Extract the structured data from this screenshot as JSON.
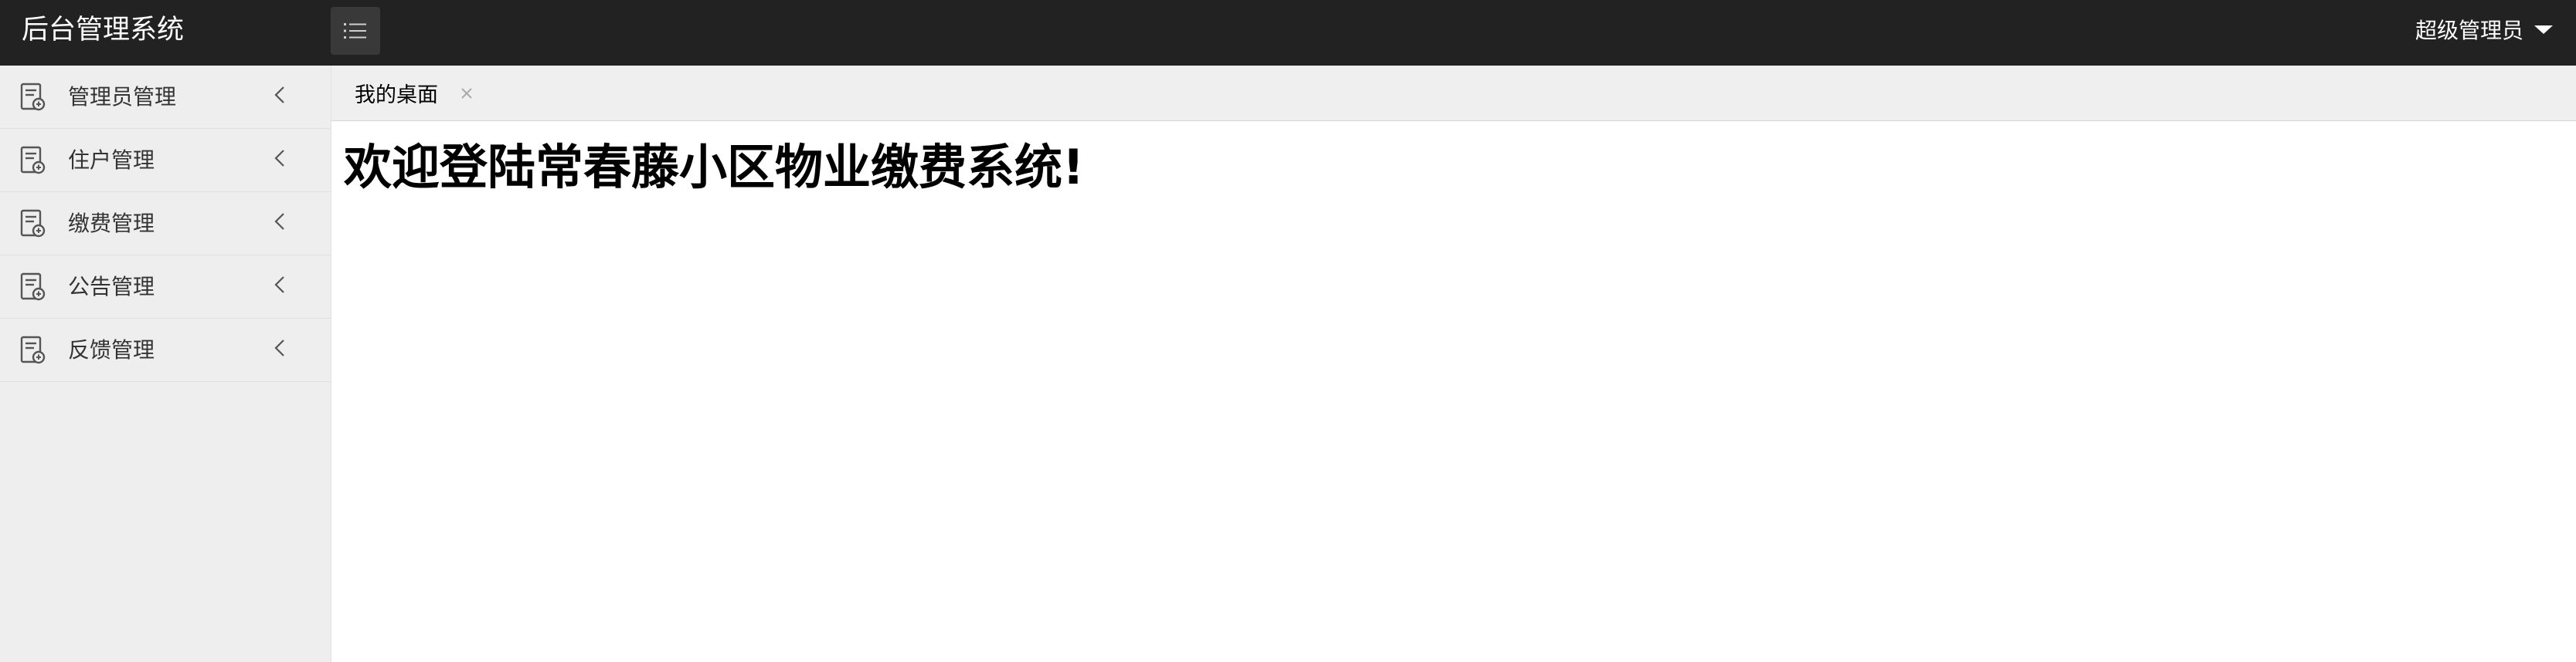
{
  "header": {
    "app_title": "后台管理系统",
    "menu_toggle_icon": "list-icon",
    "user_name": "超级管理员",
    "user_caret_icon": "caret-down-icon",
    "background_color": "#222222"
  },
  "sidebar": {
    "items": [
      {
        "label": "管理员管理",
        "icon": "document-icon",
        "chevron": "chevron-left-icon"
      },
      {
        "label": "住户管理",
        "icon": "document-icon",
        "chevron": "chevron-left-icon"
      },
      {
        "label": "缴费管理",
        "icon": "document-icon",
        "chevron": "chevron-left-icon"
      },
      {
        "label": "公告管理",
        "icon": "document-icon",
        "chevron": "chevron-left-icon"
      },
      {
        "label": "反馈管理",
        "icon": "document-icon",
        "chevron": "chevron-left-icon"
      }
    ]
  },
  "tabs": [
    {
      "label": "我的桌面",
      "close_icon": "close-icon"
    }
  ],
  "main": {
    "welcome_text": "欢迎登陆常春藤小区物业缴费系统!"
  }
}
